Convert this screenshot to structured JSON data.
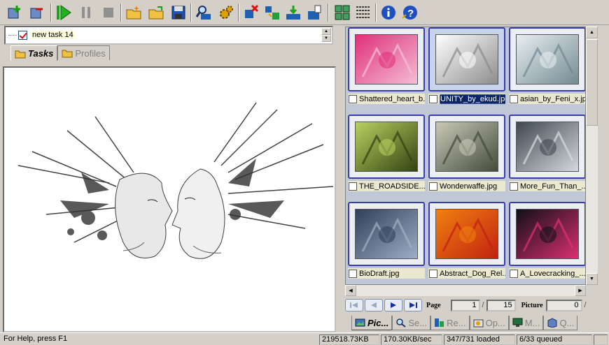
{
  "task": {
    "name": "new task 14"
  },
  "left_tabs": [
    {
      "label": "Tasks",
      "icon": "folder-icon"
    },
    {
      "label": "Profiles",
      "icon": "folder-icon"
    }
  ],
  "gallery": {
    "items": [
      {
        "caption": "Shattered_heart_b...",
        "selected": false,
        "colors": [
          "#e0307a",
          "#f4c0d8"
        ]
      },
      {
        "caption": "UNITY_by_ekud.jpg",
        "selected": true,
        "colors": [
          "#ffffff",
          "#8a8a8a"
        ]
      },
      {
        "caption": "asian_by_Feni_x.jpg",
        "selected": false,
        "colors": [
          "#e8eef0",
          "#708890"
        ]
      },
      {
        "caption": "THE_ROADSIDE...",
        "selected": false,
        "colors": [
          "#b8d060",
          "#304010"
        ]
      },
      {
        "caption": "Wonderwaffe.jpg",
        "selected": false,
        "colors": [
          "#c8c8b8",
          "#404838"
        ]
      },
      {
        "caption": "More_Fun_Than_...",
        "selected": false,
        "colors": [
          "#404850",
          "#d8dce0"
        ]
      },
      {
        "caption": "BioDraft.jpg",
        "selected": false,
        "colors": [
          "#304058",
          "#a0b0c8"
        ]
      },
      {
        "caption": "Abstract_Dog_Rel...",
        "selected": false,
        "colors": [
          "#f08010",
          "#c02010"
        ]
      },
      {
        "caption": "A_Lovecracking_...",
        "selected": false,
        "colors": [
          "#101018",
          "#e03070"
        ]
      }
    ]
  },
  "pager": {
    "page_label": "Page",
    "page_current": "1",
    "page_total": "15",
    "picture_label": "Picture",
    "picture_current": "0",
    "slash": "/"
  },
  "right_tabs": [
    {
      "label": "Pic...",
      "icon": "pictures-icon"
    },
    {
      "label": "Se...",
      "icon": "search-icon"
    },
    {
      "label": "Re...",
      "icon": "results-icon"
    },
    {
      "label": "Op...",
      "icon": "options-icon"
    },
    {
      "label": "M...",
      "icon": "monitor-icon"
    },
    {
      "label": "Q...",
      "icon": "queue-icon"
    }
  ],
  "status": {
    "help": "For Help, press F1",
    "size": "219518.73KB",
    "speed": "170.30KB/sec",
    "loaded": "347/731 loaded",
    "queued": "6/33 queued"
  },
  "colors": {
    "accent": "#3b3bb0",
    "selection": "#0a246a",
    "toolbar": "#d4d0c8"
  }
}
